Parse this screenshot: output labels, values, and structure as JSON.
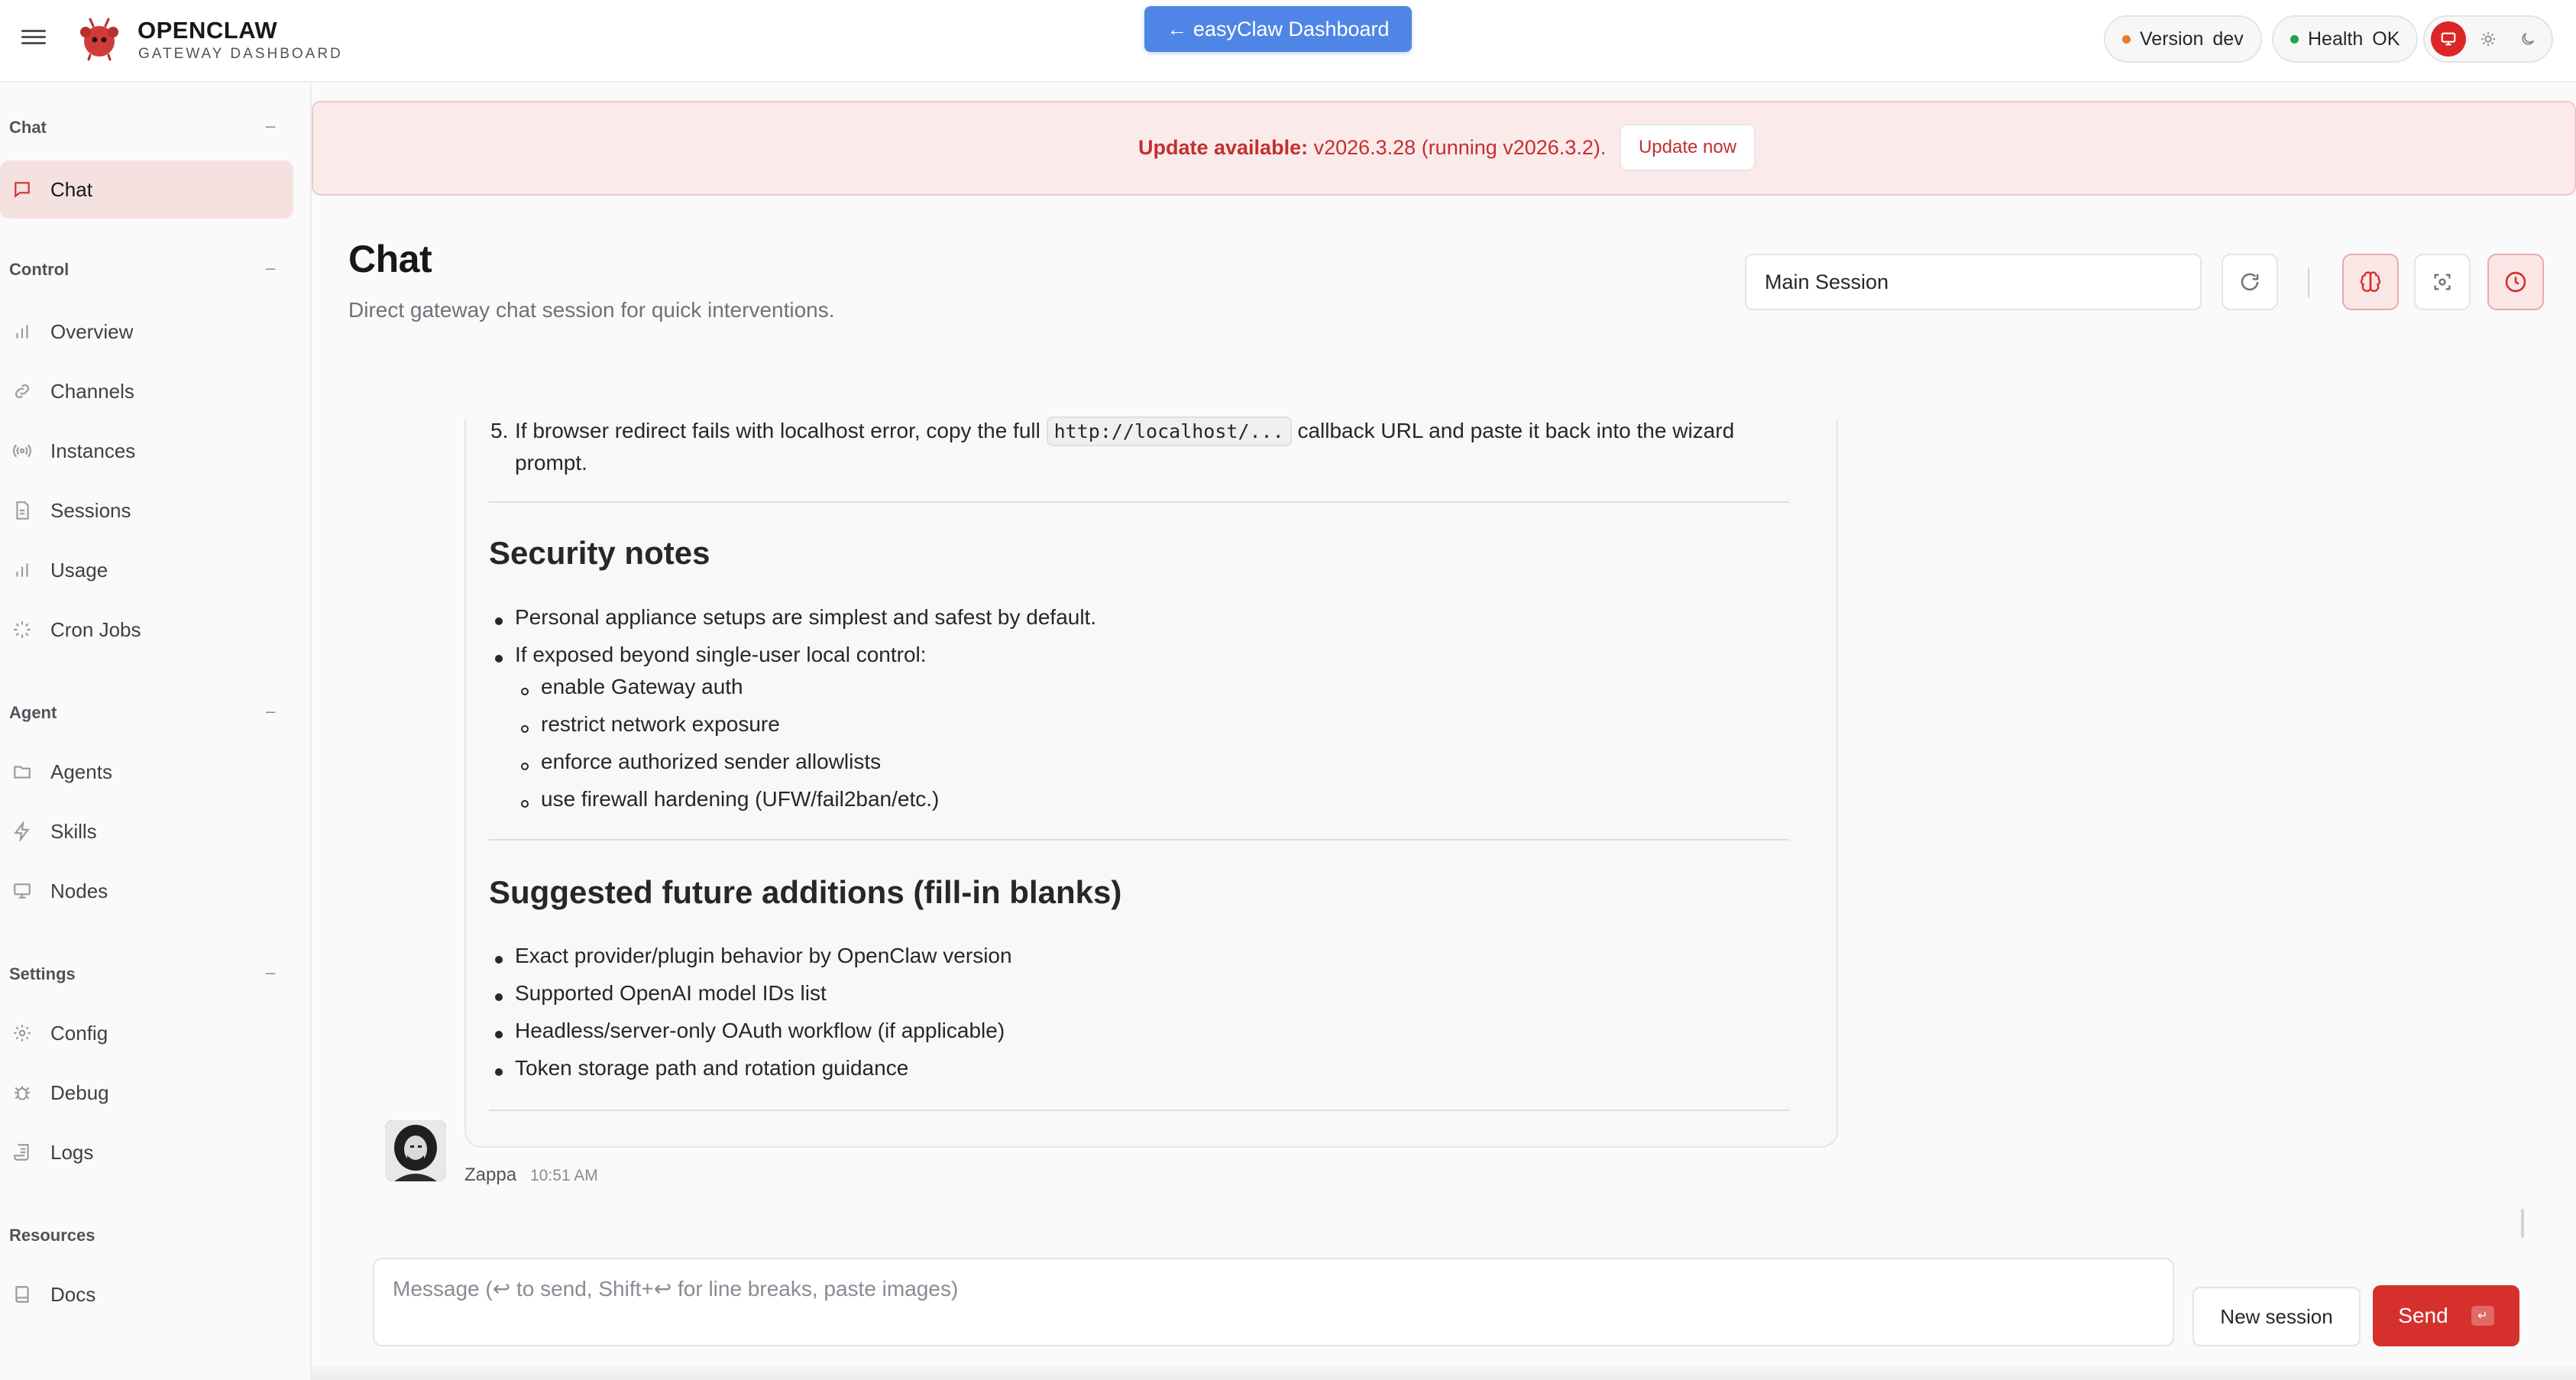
{
  "header": {
    "brand_title": "OPENCLAW",
    "brand_subtitle": "GATEWAY DASHBOARD",
    "dashboard_button": "← easyClaw Dashboard",
    "version_label": "Version",
    "version_value": "dev",
    "health_label": "Health",
    "health_value": "OK"
  },
  "sidebar": {
    "sections": [
      {
        "label": "Chat",
        "collapse": "–",
        "items": [
          {
            "label": "Chat",
            "icon": "chat-bubble-icon",
            "active": true
          }
        ]
      },
      {
        "label": "Control",
        "collapse": "–",
        "items": [
          {
            "label": "Overview",
            "icon": "bar-chart-icon"
          },
          {
            "label": "Channels",
            "icon": "link-icon"
          },
          {
            "label": "Instances",
            "icon": "radio-icon"
          },
          {
            "label": "Sessions",
            "icon": "document-icon"
          },
          {
            "label": "Usage",
            "icon": "bar-chart-icon"
          },
          {
            "label": "Cron Jobs",
            "icon": "loader-icon"
          }
        ]
      },
      {
        "label": "Agent",
        "collapse": "–",
        "items": [
          {
            "label": "Agents",
            "icon": "folder-icon"
          },
          {
            "label": "Skills",
            "icon": "lightning-icon"
          },
          {
            "label": "Nodes",
            "icon": "monitor-icon"
          }
        ]
      },
      {
        "label": "Settings",
        "collapse": "–",
        "items": [
          {
            "label": "Config",
            "icon": "gear-icon"
          },
          {
            "label": "Debug",
            "icon": "bug-icon"
          },
          {
            "label": "Logs",
            "icon": "scroll-icon"
          }
        ]
      },
      {
        "label": "Resources",
        "items": [
          {
            "label": "Docs",
            "icon": "book-icon"
          }
        ]
      }
    ]
  },
  "banner": {
    "label": "Update available:",
    "text": " v2026.3.28 (running v2026.3.2).",
    "button": "Update now"
  },
  "page": {
    "title": "Chat",
    "subtitle": "Direct gateway chat session for quick interventions.",
    "session_select": "Main Session",
    "divider": "|"
  },
  "message": {
    "step5_num": "5.",
    "step5_before": "If browser redirect fails with localhost error, copy the full",
    "step5_code": "http://localhost/...",
    "step5_after": "callback URL and paste it back into the wizard",
    "step5_cont": "prompt.",
    "security_heading": "Security notes",
    "security_items": [
      "Personal appliance setups are simplest and safest by default.",
      "If exposed beyond single-user local control:"
    ],
    "security_subitems": [
      "enable Gateway auth",
      "restrict network exposure",
      "enforce authorized sender allowlists",
      "use firewall hardening (UFW/fail2ban/etc.)"
    ],
    "future_heading": "Suggested future additions (fill-in blanks)",
    "future_items": [
      "Exact provider/plugin behavior by OpenClaw version",
      "Supported OpenAI model IDs list",
      "Headless/server-only OAuth workflow (if applicable)",
      "Token storage path and rotation guidance"
    ],
    "sender": "Zappa",
    "time": "10:51 AM"
  },
  "composer": {
    "placeholder": "Message (↩ to send, Shift+↩ for line breaks, paste images)",
    "new_session": "New session",
    "send": "Send",
    "send_kbd": "↵"
  },
  "colors": {
    "accent": "#d6302d",
    "dashboard_button": "#4f86e6",
    "version_dot": "#e57c2a",
    "health_dot": "#22a34a"
  }
}
